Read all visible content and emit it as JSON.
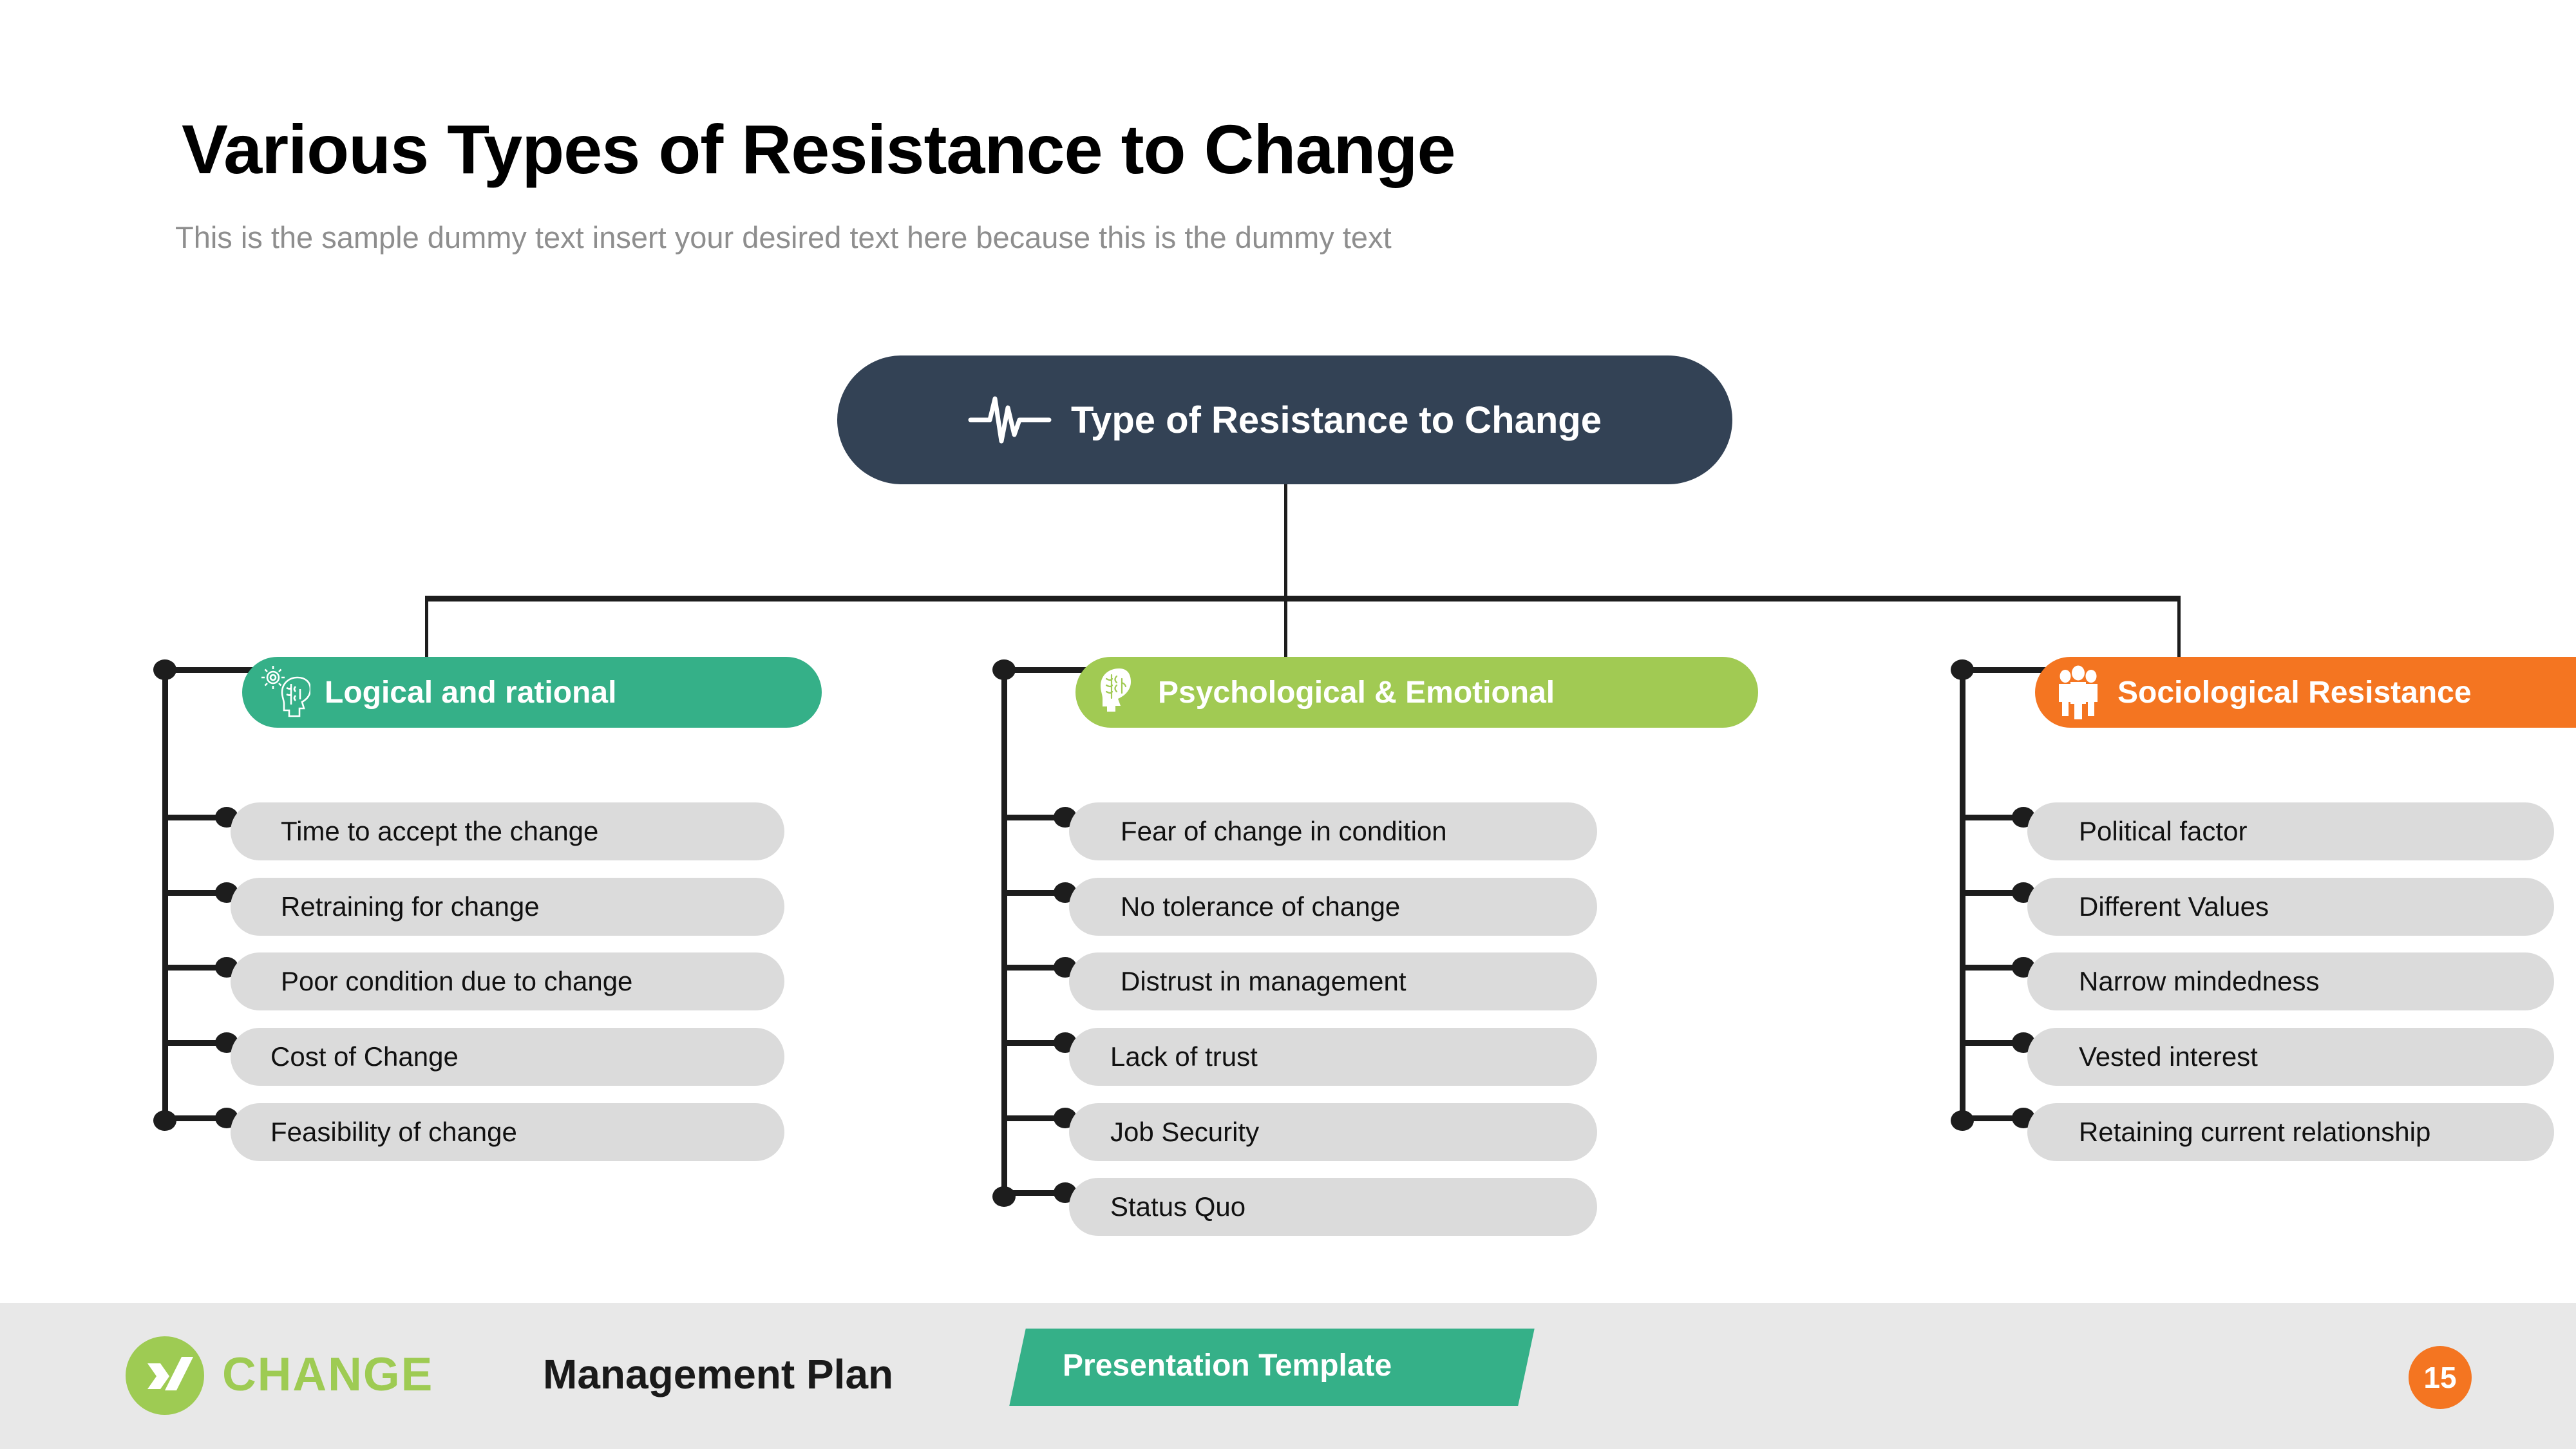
{
  "slide": {
    "title": "Various Types of Resistance to Change",
    "subtitle": "This is the sample dummy text insert your desired text here because this is the dummy text"
  },
  "root": {
    "label": "Type of Resistance to Change",
    "icon": "pulse-heartbeat-icon",
    "color": "#334255"
  },
  "columns": [
    {
      "label": "Logical and rational",
      "icon": "head-gear-brain-icon",
      "color": "#35B088",
      "items": [
        "Time to accept the change",
        "Retraining  for change",
        "Poor condition due to change",
        "Cost of Change",
        "Feasibility of change"
      ]
    },
    {
      "label": "Psychological & Emotional",
      "icon": "head-brain-icon",
      "color": "#A1CA53",
      "items": [
        "Fear of change in condition",
        "No tolerance of change",
        "Distrust in management",
        "Lack of trust",
        "Job Security",
        "Status Quo"
      ]
    },
    {
      "label": "Sociological Resistance",
      "icon": "people-group-icon",
      "color": "#F47521",
      "items": [
        "Political factor",
        "Different Values",
        "Narrow mindedness",
        "Vested interest",
        "Retaining current relationship"
      ]
    }
  ],
  "footer": {
    "logo_icon": "xing-x-logo-icon",
    "brand_primary": "CHANGE",
    "brand_secondary": "Management Plan",
    "template_tag": "Presentation Template",
    "page_number": "15",
    "colors": {
      "band": "#E8E8E8",
      "brand_green": "#9ECB53",
      "tag_green": "#35B088",
      "page_orange": "#F47521"
    }
  }
}
